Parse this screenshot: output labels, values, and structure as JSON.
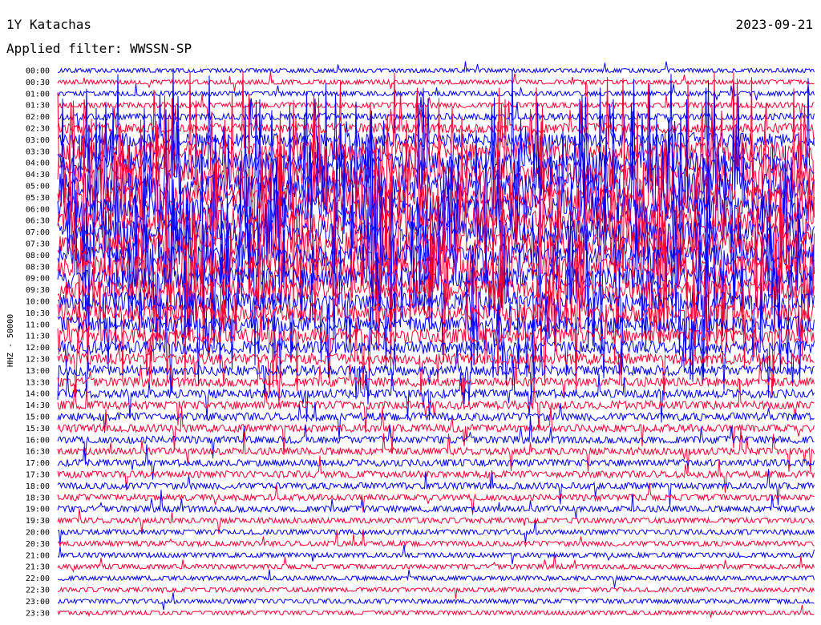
{
  "header": {
    "station": "1Y Katachas",
    "date": "2023-09-21",
    "filter_label": "Applied filter: WWSSN-SP"
  },
  "chart_data": {
    "type": "helicorder",
    "title": "1Y Katachas",
    "date": "2023-09-21",
    "filter": "WWSSN-SP",
    "ylabel": "HHZ - 50000",
    "row_labels": [
      "00:00",
      "00:30",
      "01:00",
      "01:30",
      "02:00",
      "02:30",
      "03:00",
      "03:30",
      "04:00",
      "04:30",
      "05:00",
      "05:30",
      "06:00",
      "06:30",
      "07:00",
      "07:30",
      "08:00",
      "08:30",
      "09:00",
      "09:30",
      "10:00",
      "10:30",
      "11:00",
      "11:30",
      "12:00",
      "12:30",
      "13:00",
      "13:30",
      "14:00",
      "14:30",
      "15:00",
      "15:30",
      "16:00",
      "16:30",
      "17:00",
      "17:30",
      "18:00",
      "18:30",
      "19:00",
      "19:30",
      "20:00",
      "20:30",
      "21:00",
      "21:30",
      "22:00",
      "22:30",
      "23:00",
      "23:30"
    ],
    "trace_colors": [
      "#0000ff",
      "#ff0033"
    ],
    "activity_level": [
      0.6,
      0.7,
      0.8,
      1.0,
      1.4,
      2.2,
      3.5,
      5.0,
      6.0,
      6.5,
      6.8,
      7.0,
      7.0,
      6.8,
      6.5,
      6.2,
      6.0,
      5.8,
      5.5,
      5.2,
      4.8,
      4.5,
      4.0,
      3.6,
      3.2,
      2.6,
      2.3,
      2.0,
      1.9,
      1.8,
      1.7,
      1.6,
      1.5,
      1.5,
      1.4,
      1.4,
      1.3,
      1.2,
      1.2,
      1.0,
      0.9,
      0.9,
      0.8,
      0.8,
      0.7,
      0.7,
      0.7,
      0.6
    ],
    "grid": false
  }
}
